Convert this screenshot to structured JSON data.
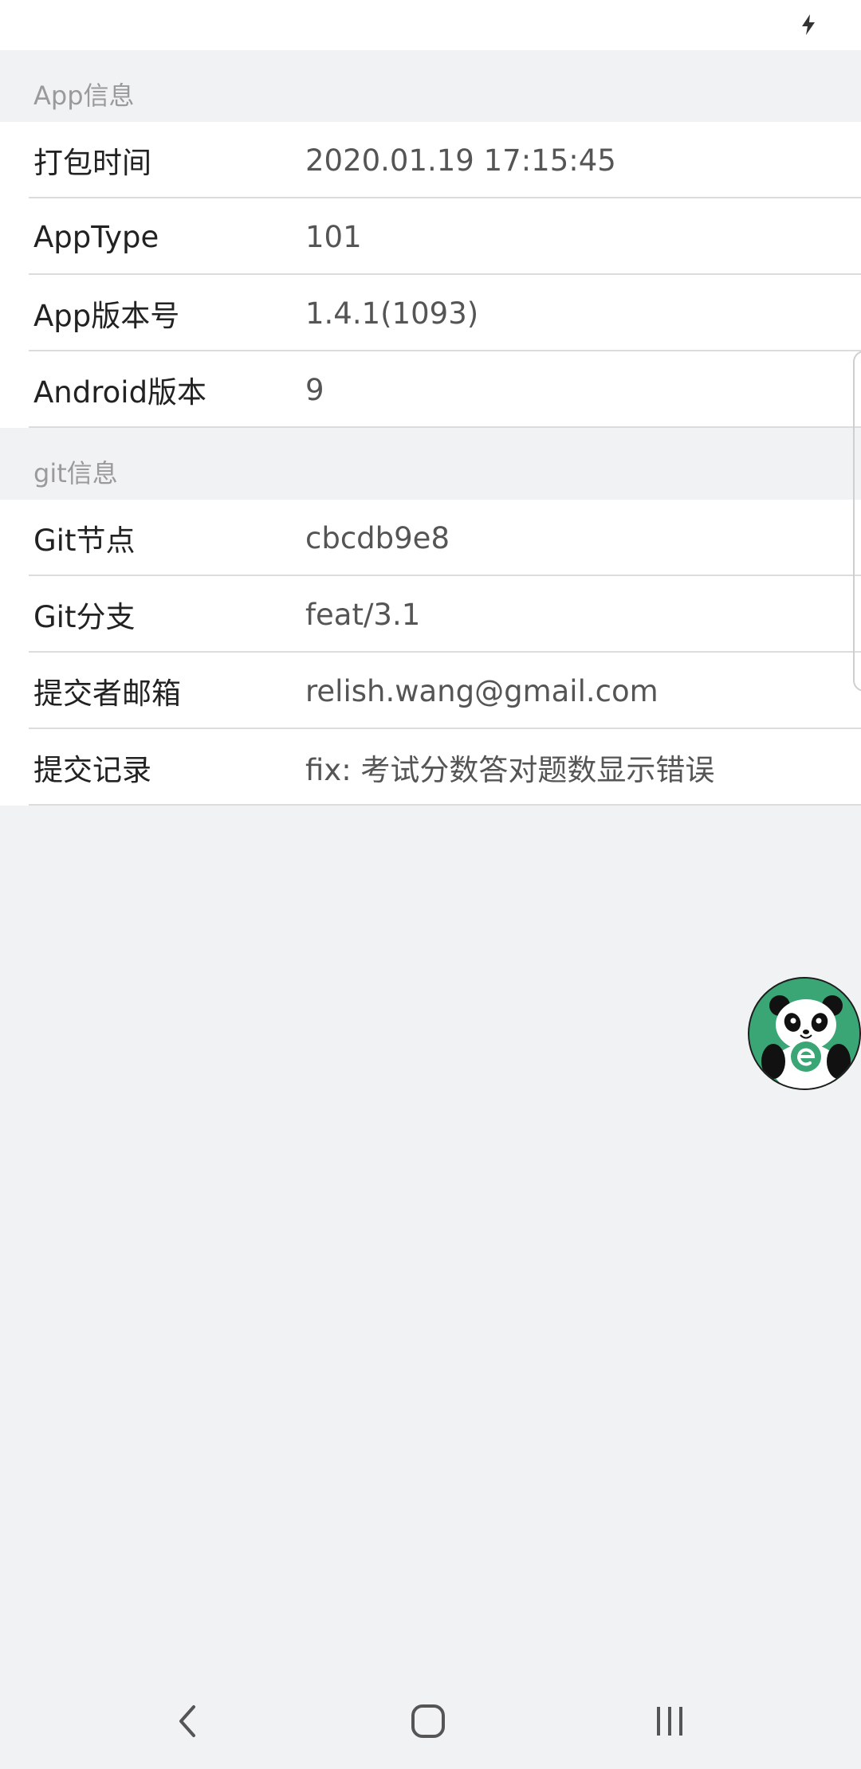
{
  "status_bar": {
    "icon": "charging-icon"
  },
  "sections": [
    {
      "header": "App信息",
      "rows": [
        {
          "label": "打包时间",
          "value": "2020.01.19 17:15:45"
        },
        {
          "label": "AppType",
          "value": "101"
        },
        {
          "label": "App版本号",
          "value": "1.4.1(1093)"
        },
        {
          "label": "Android版本",
          "value": "9"
        }
      ]
    },
    {
      "header": "git信息",
      "rows": [
        {
          "label": "Git节点",
          "value": "cbcdb9e8"
        },
        {
          "label": "Git分支",
          "value": "feat/3.1"
        },
        {
          "label": "提交者邮箱",
          "value": "relish.wang@gmail.com"
        },
        {
          "label": "提交记录",
          "value": "fix: 考试分数答对题数显示错误"
        }
      ]
    }
  ],
  "floating_button": {
    "icon": "panda-mascot-icon",
    "color": "#3aa575"
  },
  "nav_bar": {
    "back": "back-icon",
    "home": "home-icon",
    "recents": "recents-icon"
  },
  "colors": {
    "background": "#f1f2f4",
    "row_background": "#ffffff",
    "header_text": "#9a9a9a",
    "label_text": "#222222",
    "value_text": "#555555"
  }
}
